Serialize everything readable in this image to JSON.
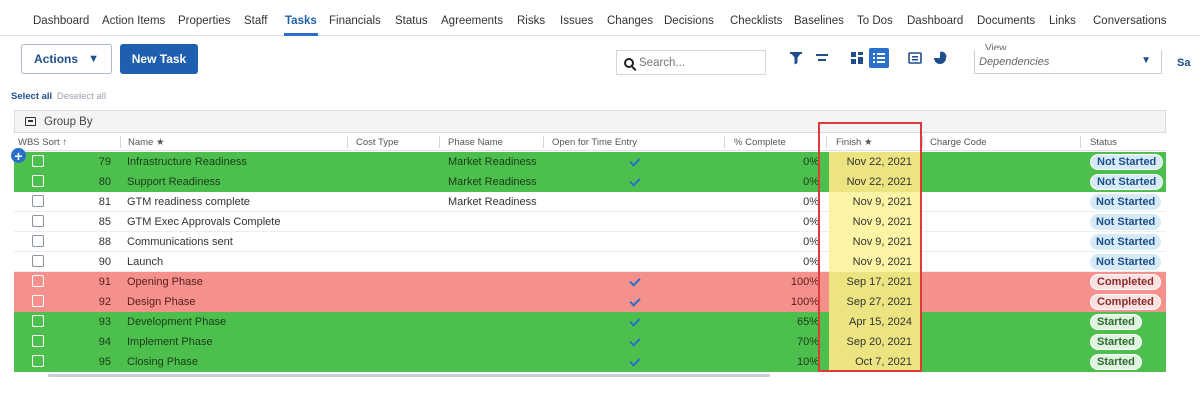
{
  "nav": {
    "tabs": [
      "Dashboard",
      "Action Items",
      "Properties",
      "Staff",
      "Tasks",
      "Financials",
      "Status",
      "Agreements",
      "Risks",
      "Issues",
      "Changes",
      "Decisions",
      "Checklists",
      "Baselines",
      "To Dos",
      "Dashboard",
      "Documents",
      "Links",
      "Conversations"
    ],
    "active": "Tasks"
  },
  "toolbar": {
    "actions_label": "Actions",
    "new_task_label": "New Task",
    "search_placeholder": "Search...",
    "view_label": "View",
    "view_value": "Dependencies",
    "view_overflow": "Sa"
  },
  "selection": {
    "select_all": "Select all",
    "deselect_all": "Deselect all"
  },
  "group_by": "Group By",
  "table": {
    "columns": [
      "WBS Sort ↑",
      "Name ★",
      "Cost Type",
      "Phase Name",
      "Open for Time Entry",
      "% Complete",
      "Finish ★",
      "Charge Code",
      "Status"
    ],
    "rows": [
      {
        "wbs": "79",
        "name": "Infrastructure Readiness",
        "phase": "Market Readiness",
        "open": true,
        "pct": "0%",
        "finish": "Nov 22, 2021",
        "status": "Not Started",
        "color": "green"
      },
      {
        "wbs": "80",
        "name": "Support Readiness",
        "phase": "Market Readiness",
        "open": true,
        "pct": "0%",
        "finish": "Nov 22, 2021",
        "status": "Not Started",
        "color": "green"
      },
      {
        "wbs": "81",
        "name": "GTM readiness complete",
        "phase": "Market Readiness",
        "open": false,
        "pct": "0%",
        "finish": "Nov 9, 2021",
        "status": "Not Started",
        "color": "white"
      },
      {
        "wbs": "85",
        "name": "GTM Exec Approvals Complete",
        "phase": "",
        "open": false,
        "pct": "0%",
        "finish": "Nov 9, 2021",
        "status": "Not Started",
        "color": "white"
      },
      {
        "wbs": "88",
        "name": "Communications sent",
        "phase": "",
        "open": false,
        "pct": "0%",
        "finish": "Nov 9, 2021",
        "status": "Not Started",
        "color": "white"
      },
      {
        "wbs": "90",
        "name": "Launch",
        "phase": "",
        "open": false,
        "pct": "0%",
        "finish": "Nov 9, 2021",
        "status": "Not Started",
        "color": "white"
      },
      {
        "wbs": "91",
        "name": "Opening Phase",
        "phase": "",
        "open": true,
        "pct": "100%",
        "finish": "Sep 17, 2021",
        "status": "Completed",
        "color": "red"
      },
      {
        "wbs": "92",
        "name": "Design Phase",
        "phase": "",
        "open": true,
        "pct": "100%",
        "finish": "Sep 27, 2021",
        "status": "Completed",
        "color": "red"
      },
      {
        "wbs": "93",
        "name": "Development Phase",
        "phase": "",
        "open": true,
        "pct": "65%",
        "finish": "Apr 15, 2024",
        "status": "Started",
        "color": "green"
      },
      {
        "wbs": "94",
        "name": "Implement Phase",
        "phase": "",
        "open": true,
        "pct": "70%",
        "finish": "Sep 20, 2021",
        "status": "Started",
        "color": "green"
      },
      {
        "wbs": "95",
        "name": "Closing Phase",
        "phase": "",
        "open": true,
        "pct": "10%",
        "finish": "Oct 7, 2021",
        "status": "Started",
        "color": "green"
      }
    ]
  },
  "colors": {
    "accent": "#2a6fc9",
    "row_green": "#4cbf4c",
    "row_red": "#f4918c",
    "finish_highlight": "#ece480",
    "annotation_border": "#e0393a"
  }
}
